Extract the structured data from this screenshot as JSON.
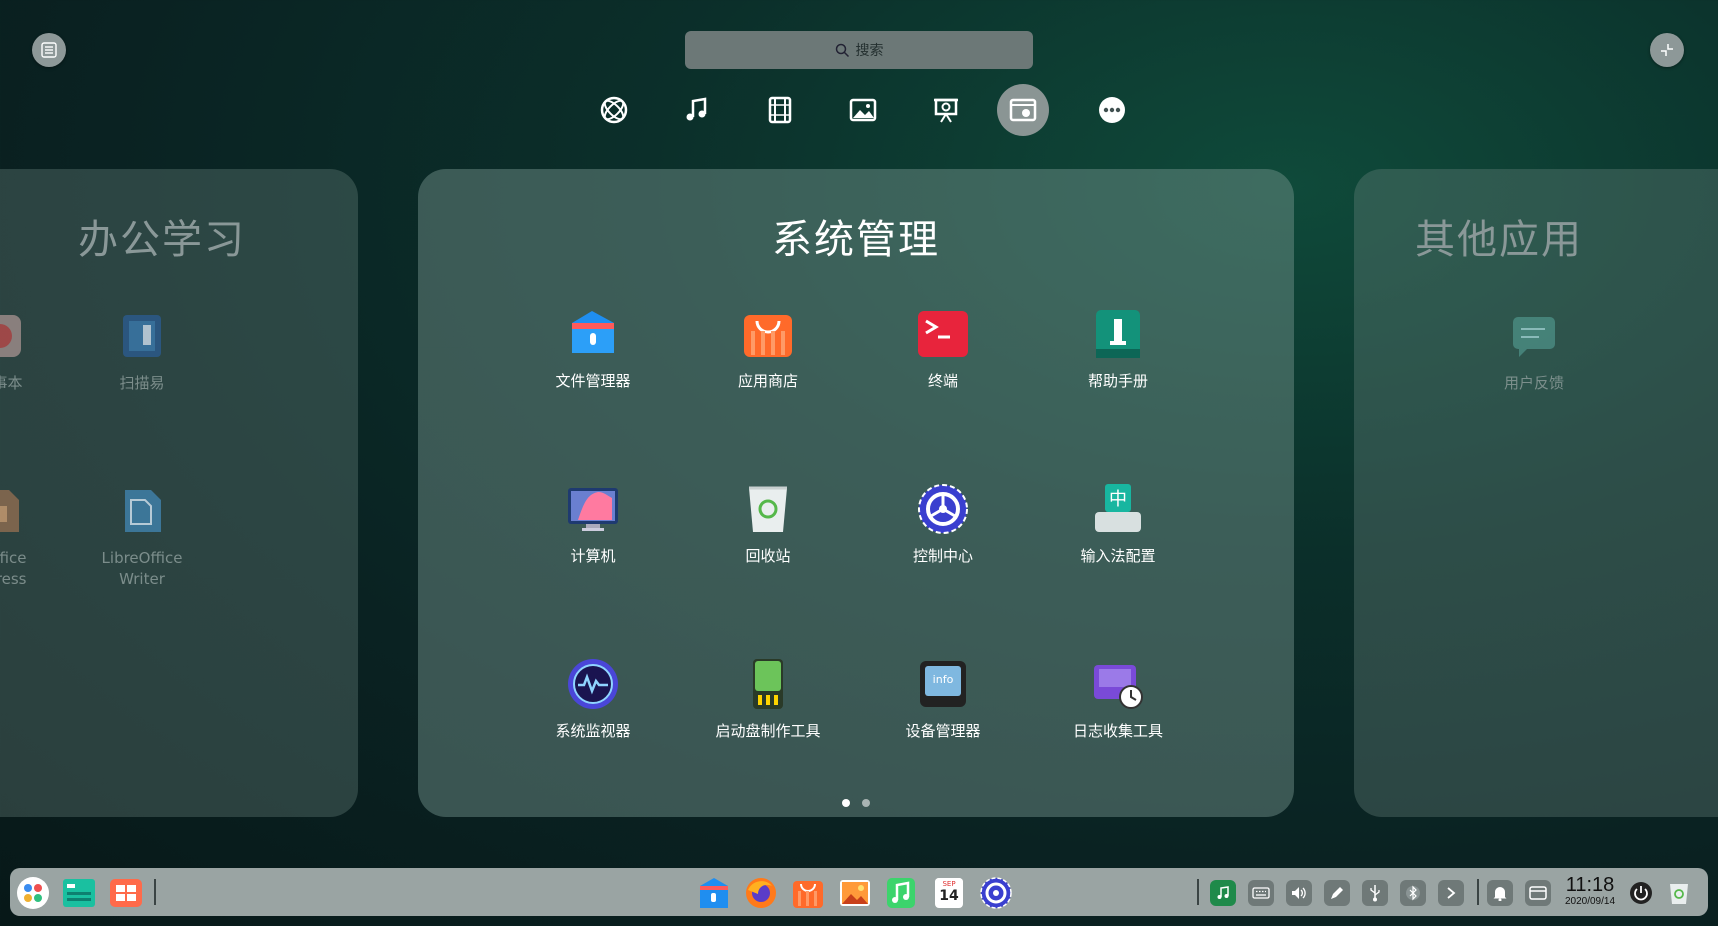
{
  "search": {
    "placeholder": "搜索"
  },
  "categories": [
    {
      "name": "internet"
    },
    {
      "name": "music"
    },
    {
      "name": "video"
    },
    {
      "name": "image"
    },
    {
      "name": "office"
    },
    {
      "name": "system",
      "active": true
    },
    {
      "name": "more"
    }
  ],
  "panels": {
    "left": {
      "title": "办公学习",
      "apps": [
        {
          "label": "记事本"
        },
        {
          "label": "扫描易"
        },
        {
          "label": "eOffice\npress"
        },
        {
          "label": "LibreOffice\nWriter"
        }
      ]
    },
    "main": {
      "title": "系统管理",
      "apps": [
        {
          "label": "文件管理器",
          "icon": "file-manager-icon"
        },
        {
          "label": "应用商店",
          "icon": "app-store-icon"
        },
        {
          "label": "终端",
          "icon": "terminal-icon"
        },
        {
          "label": "帮助手册",
          "icon": "help-manual-icon"
        },
        {
          "label": "计算机",
          "icon": "computer-icon"
        },
        {
          "label": "回收站",
          "icon": "trash-icon"
        },
        {
          "label": "控制中心",
          "icon": "control-center-icon"
        },
        {
          "label": "输入法配置",
          "icon": "input-method-icon"
        },
        {
          "label": "系统监视器",
          "icon": "system-monitor-icon"
        },
        {
          "label": "启动盘制作工具",
          "icon": "boot-maker-icon"
        },
        {
          "label": "设备管理器",
          "icon": "device-manager-icon"
        },
        {
          "label": "日志收集工具",
          "icon": "log-collector-icon"
        }
      ]
    },
    "right": {
      "title": "其他应用",
      "apps": [
        {
          "label": "用户反馈"
        }
      ]
    }
  },
  "pagination": {
    "pages": 2,
    "current": 1
  },
  "clock": {
    "time": "11:18",
    "date": "2020/09/14"
  },
  "calendar_icon": {
    "month": "SEP",
    "day": "14"
  },
  "colors": {
    "accent": "#2f8fff",
    "panel": "#6e8c88",
    "dock": "#9aa4a3"
  }
}
